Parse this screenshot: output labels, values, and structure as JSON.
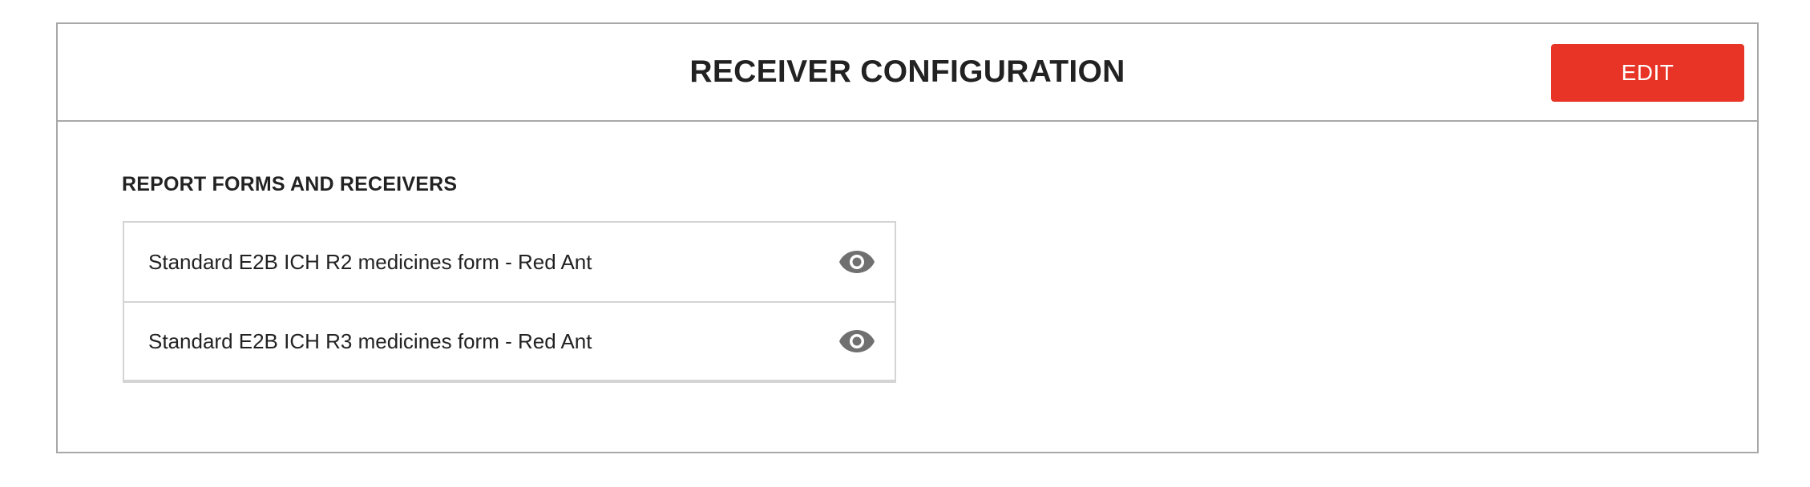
{
  "header": {
    "title": "RECEIVER CONFIGURATION",
    "edit_label": "EDIT"
  },
  "section": {
    "heading": "REPORT FORMS AND RECEIVERS",
    "forms": [
      {
        "label": "Standard E2B ICH R2 medicines form - Red Ant",
        "icon": "eye-icon"
      },
      {
        "label": "Standard E2B ICH R3 medicines form - Red Ant",
        "icon": "eye-icon"
      }
    ]
  },
  "colors": {
    "accent": "#e83427",
    "border": "#a8a8a8",
    "icon": "#707070"
  }
}
